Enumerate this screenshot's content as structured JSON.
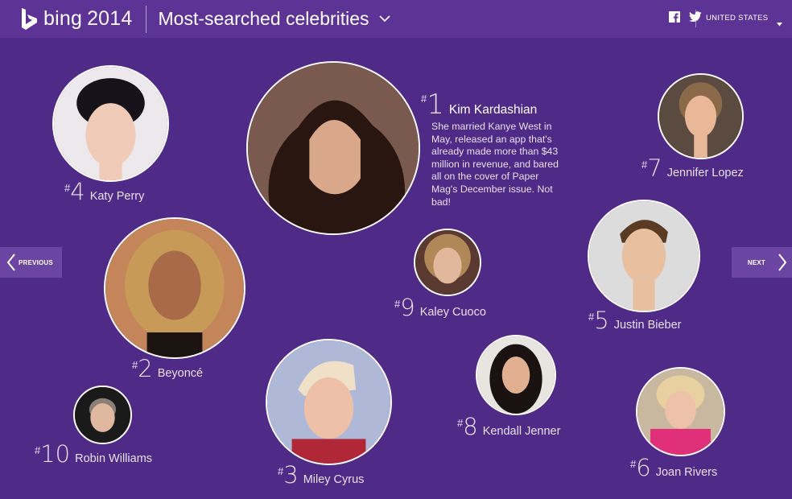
{
  "header": {
    "brand": "bing",
    "year": "2014",
    "title": "Most-searched celebrities",
    "region": "UNITED STATES",
    "social": [
      "facebook-icon",
      "twitter-icon"
    ]
  },
  "nav": {
    "previous": "PREVIOUS",
    "next": "NEXT"
  },
  "colors": {
    "background": "#4f2a86",
    "header": "#5d3396",
    "nav_button": "#6c45a2"
  },
  "celebrities": [
    {
      "rank": "1",
      "name": "Kim Kardashian",
      "description": "She married Kanye West in May, released an app that's already made more than $43 million in revenue, and bared all on the cover of Paper Mag's December issue. Not bad!"
    },
    {
      "rank": "2",
      "name": "Beyoncé"
    },
    {
      "rank": "3",
      "name": "Miley Cyrus"
    },
    {
      "rank": "4",
      "name": "Katy Perry"
    },
    {
      "rank": "5",
      "name": "Justin Bieber"
    },
    {
      "rank": "6",
      "name": "Joan Rivers"
    },
    {
      "rank": "7",
      "name": "Jennifer Lopez"
    },
    {
      "rank": "8",
      "name": "Kendall Jenner"
    },
    {
      "rank": "9",
      "name": "Kaley Cuoco"
    },
    {
      "rank": "10",
      "name": "Robin Williams"
    }
  ]
}
